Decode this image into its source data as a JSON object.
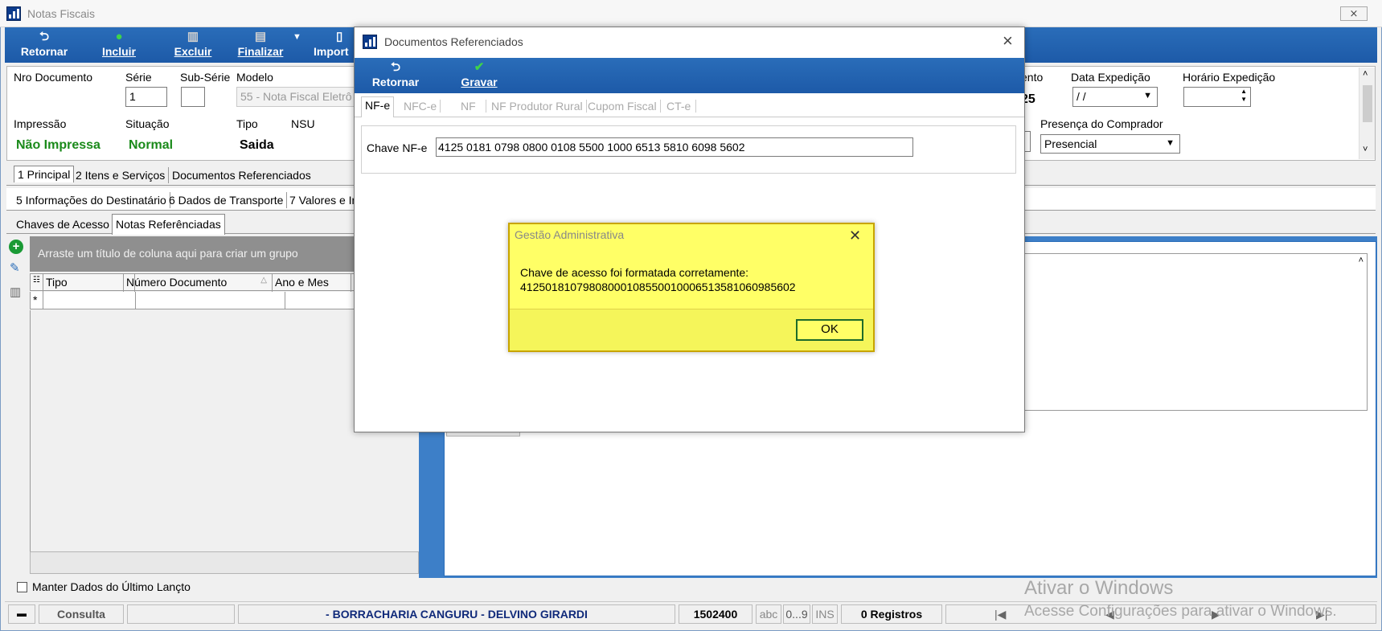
{
  "window": {
    "title": "Notas Fiscais",
    "close": "⨯"
  },
  "toolbar": {
    "retornar": "Retornar",
    "incluir": "Incluir",
    "excluir": "Excluir",
    "finalizar": "Finalizar",
    "importar": "Import"
  },
  "form": {
    "nro_documento_label": "Nro Documento",
    "serie_label": "Série",
    "serie_value": "1",
    "subserie_label": "Sub-Série",
    "modelo_label": "Modelo",
    "modelo_value": "55 - Nota Fiscal Eletrô",
    "impressao_label": "Impressão",
    "impressao_value": "Não Impressa",
    "situacao_label": "Situação",
    "situacao_value": "Normal",
    "tipo_label": "Tipo",
    "tipo_value": "Saida",
    "nsu_label": "NSU",
    "emissao_partial_label": "ento",
    "emissao_partial_value": "25",
    "data_expedicao_label": "Data Expedição",
    "data_expedicao_value": " / /",
    "horario_expedicao_label": "Horário Expedição",
    "presenca_label": "Presença do Comprador",
    "presenca_value": "Presencial"
  },
  "tabs_row1": [
    "1 Principal",
    "2 Itens e Serviços",
    "Documentos Referenciados"
  ],
  "tabs_row2": [
    "5 Informações do Destinatário",
    "6 Dados de Transporte",
    "7 Valores e Im"
  ],
  "subtabs": [
    "Chaves de Acesso",
    "Notas Referênciadas"
  ],
  "grid": {
    "group_hint": "Arraste um título de coluna aqui para criar um grupo",
    "columns": [
      "Tipo",
      "Número Documento",
      "Ano e Mes"
    ],
    "new_row_marker": "*"
  },
  "manter_dados": "Manter Dados do Último Lançto",
  "statusbar": {
    "mode": "Consulta",
    "company": "-  BORRACHARIA CANGURU - DELVINO GIRARDI",
    "code": "1502400",
    "abc": "abc",
    "num": "0...9",
    "ins": "INS",
    "records": "0 Registros"
  },
  "watermark": {
    "line1": "Ativar o Windows",
    "line2": "Acesse Configurações para ativar o Windows."
  },
  "dialog": {
    "title": "Documentos Referenciados",
    "retornar": "Retornar",
    "gravar": "Gravar",
    "tabs": [
      "NF-e",
      "NFC-e",
      "NF",
      "NF Produtor Rural",
      "Cupom Fiscal",
      "CT-e"
    ],
    "chave_label": "Chave NF-e",
    "chave_value": "4125 0181 0798 0800 0108 5500 1000 6513 5810 6098 5602"
  },
  "message": {
    "title": "Gestão Administrativa",
    "line1": "Chave de acesso foi formatada corretamente:",
    "line2": "41250181079808000108550010006513581060985602",
    "ok": "OK"
  }
}
